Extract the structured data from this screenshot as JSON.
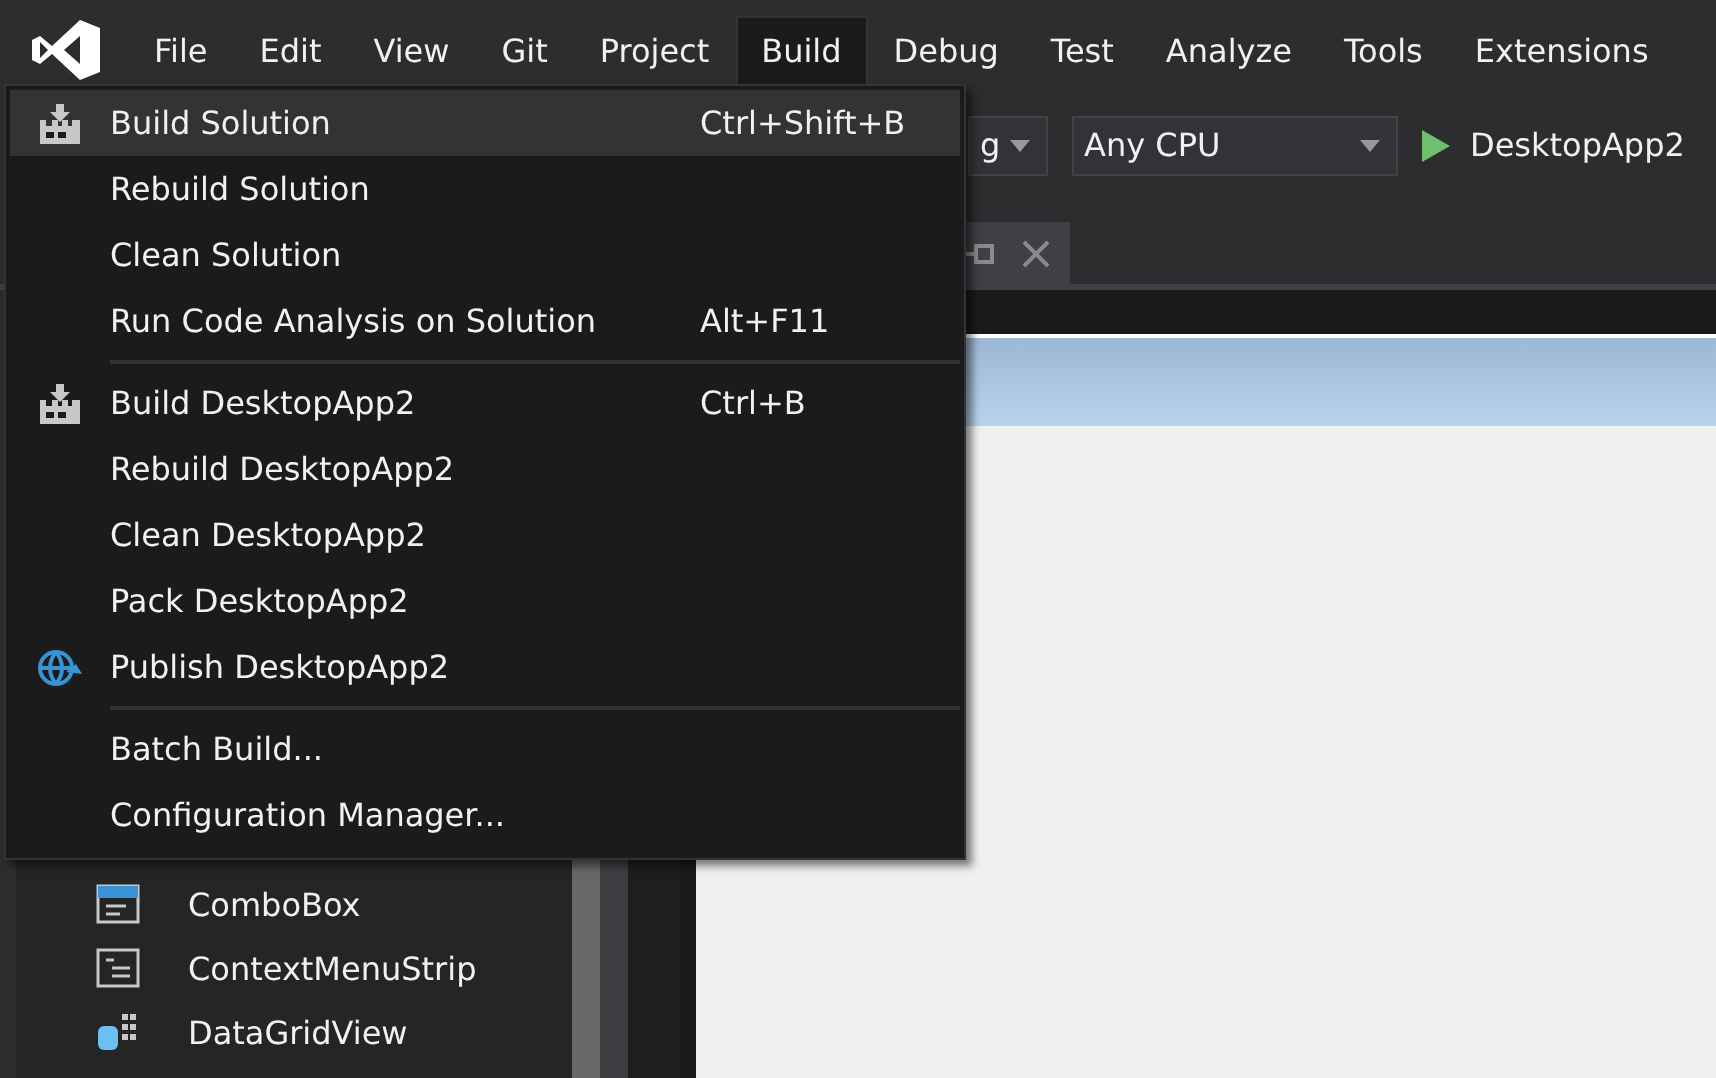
{
  "menubar": [
    {
      "label": "File",
      "selected": false
    },
    {
      "label": "Edit",
      "selected": false
    },
    {
      "label": "View",
      "selected": false
    },
    {
      "label": "Git",
      "selected": false
    },
    {
      "label": "Project",
      "selected": false
    },
    {
      "label": "Build",
      "selected": true
    },
    {
      "label": "Debug",
      "selected": false
    },
    {
      "label": "Test",
      "selected": false
    },
    {
      "label": "Analyze",
      "selected": false
    },
    {
      "label": "Tools",
      "selected": false
    },
    {
      "label": "Extensions",
      "selected": false
    }
  ],
  "toolbar": {
    "configuration": "g",
    "platform": "Any CPU",
    "start": "DesktopApp2"
  },
  "toolbox": [
    {
      "label": "ComboBox"
    },
    {
      "label": "ContextMenuStrip"
    },
    {
      "label": "DataGridView"
    }
  ],
  "build_menu": [
    {
      "kind": "item",
      "label": "Build Solution",
      "shortcut": "Ctrl+Shift+B",
      "selected": true
    },
    {
      "kind": "item",
      "label": "Rebuild Solution",
      "selected": false
    },
    {
      "kind": "item",
      "label": "Clean Solution",
      "selected": false
    },
    {
      "kind": "item",
      "label": "Run Code Analysis on Solution",
      "shortcut": "Alt+F11",
      "selected": false
    },
    {
      "kind": "separator"
    },
    {
      "kind": "item",
      "label": "Build DesktopApp2",
      "shortcut": "Ctrl+B",
      "selected": false
    },
    {
      "kind": "item",
      "label": "Rebuild DesktopApp2",
      "selected": false
    },
    {
      "kind": "item",
      "label": "Clean DesktopApp2",
      "selected": false
    },
    {
      "kind": "item",
      "label": "Pack DesktopApp2",
      "selected": false
    },
    {
      "kind": "item",
      "label": "Publish DesktopApp2",
      "selected": false
    },
    {
      "kind": "separator"
    },
    {
      "kind": "item",
      "label": "Batch Build...",
      "selected": false
    },
    {
      "kind": "item",
      "label": "Configuration Manager...",
      "selected": false
    }
  ]
}
